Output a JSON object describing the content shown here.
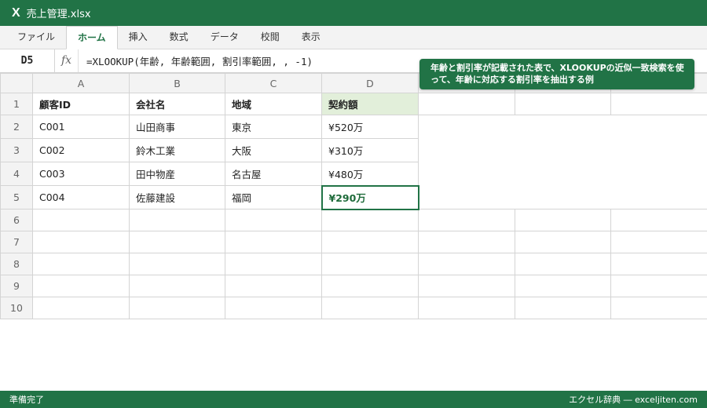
{
  "titlebar": {
    "logo": "X",
    "filename": "売上管理.xlsx"
  },
  "ribbon": {
    "tabs": [
      "ファイル",
      "ホーム",
      "挿入",
      "数式",
      "データ",
      "校閲",
      "表示"
    ],
    "active_tab": "ホーム"
  },
  "formula_bar": {
    "cell_ref": "D5",
    "fx": "fx",
    "formula": "=XLOOKUP(年齢, 年齢範囲, 割引率範囲, , -1)"
  },
  "grid": {
    "columns": [
      "A",
      "B",
      "C",
      "D",
      "",
      "",
      ""
    ],
    "row_numbers": [
      "1",
      "2",
      "3",
      "4",
      "5",
      "6",
      "7",
      "8",
      "9",
      "10"
    ],
    "header_row": [
      "顧客ID",
      "会社名",
      "地域",
      "契約額"
    ],
    "rows": [
      [
        "C001",
        "山田商事",
        "東京",
        "¥520万"
      ],
      [
        "C002",
        "鈴木工業",
        "大阪",
        "¥310万"
      ],
      [
        "C003",
        "田中物産",
        "名古屋",
        "¥480万"
      ],
      [
        "C004",
        "佐藤建設",
        "福岡",
        "¥290万"
      ]
    ],
    "selected_cell": "D5"
  },
  "callout": {
    "text": "年齢と割引率が記載された表で、XLOOKUPの近似一致検索を使って、年齢に対応する割引率を抽出する例"
  },
  "statusbar": {
    "left": "準備完了",
    "right": "エクセル辞典 ― exceljiten.com"
  },
  "colors": {
    "accent": "#217346",
    "selected_fill": "#e2efda"
  }
}
